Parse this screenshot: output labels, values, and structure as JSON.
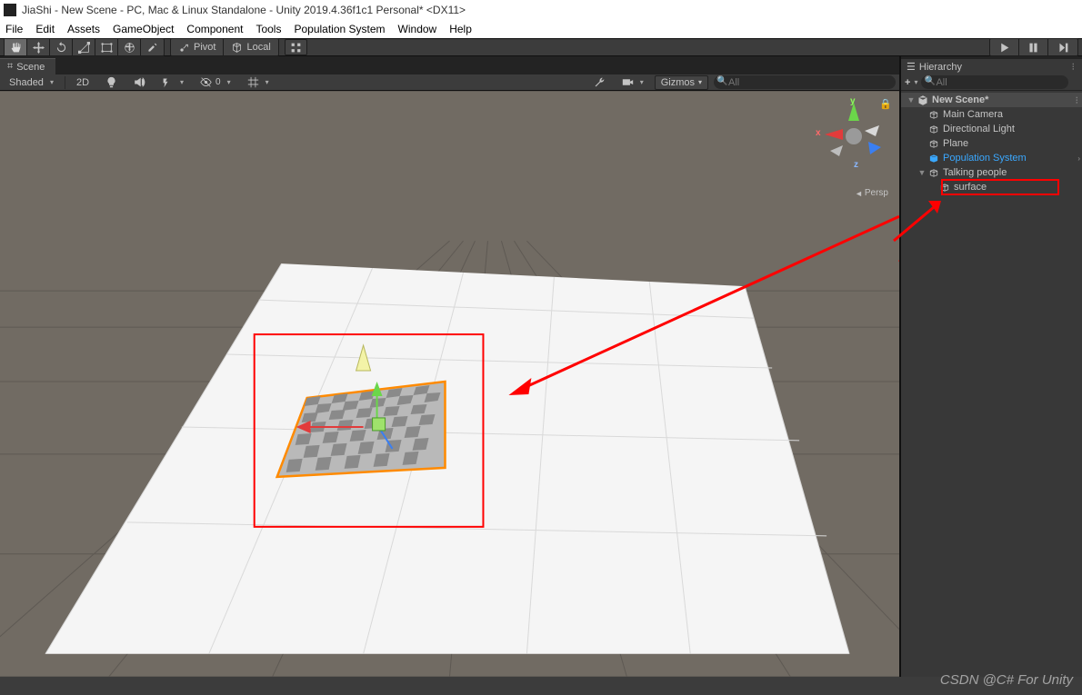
{
  "title": "JiaShi - New Scene - PC, Mac & Linux Standalone - Unity 2019.4.36f1c1 Personal* <DX11>",
  "menu": [
    "File",
    "Edit",
    "Assets",
    "GameObject",
    "Component",
    "Tools",
    "Population System",
    "Window",
    "Help"
  ],
  "toolbar": {
    "pivot": "Pivot",
    "local": "Local"
  },
  "scene": {
    "tab": "Scene",
    "shaded": "Shaded",
    "twoD": "2D",
    "gizmos": "Gizmos",
    "search_placeholder": "All",
    "persp": "Persp",
    "axes": {
      "x": "x",
      "y": "y",
      "z": "z"
    }
  },
  "hierarchy": {
    "title": "Hierarchy",
    "plus": "+",
    "search_placeholder": "All",
    "nodes": {
      "scene": "New Scene*",
      "camera": "Main Camera",
      "light": "Directional Light",
      "plane": "Plane",
      "popsys": "Population System",
      "talking": "Talking people",
      "surface": "surface"
    }
  },
  "watermark": "CSDN @C# For Unity"
}
